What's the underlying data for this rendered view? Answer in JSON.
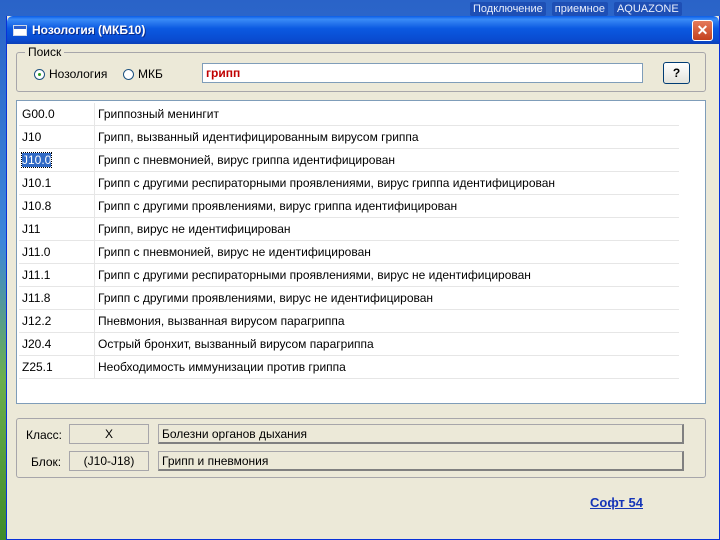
{
  "taskbar": {
    "items": [
      "Подключение",
      "приемное",
      "AQUAZONE"
    ]
  },
  "window": {
    "title": "Нозология (МКБ10)",
    "close_label": "✕"
  },
  "search": {
    "group_label": "Поиск",
    "radio_nosology": "Нозология",
    "radio_mkb": "МКБ",
    "selected": "Нозология",
    "query": "грипп",
    "help_label": "?"
  },
  "results": [
    {
      "code": "G00.0",
      "desc": "Гриппозный менингит"
    },
    {
      "code": "J10",
      "desc": "Грипп, вызванный идентифицированным вирусом гриппа"
    },
    {
      "code": "J10.0",
      "desc": "Грипп с пневмонией, вирус гриппа идентифицирован"
    },
    {
      "code": "J10.1",
      "desc": "Грипп с другими респираторными проявлениями, вирус гриппа идентифицирован"
    },
    {
      "code": "J10.8",
      "desc": "Грипп с другими проявлениями, вирус гриппа идентифицирован"
    },
    {
      "code": "J11",
      "desc": "Грипп, вирус не идентифицирован"
    },
    {
      "code": "J11.0",
      "desc": "Грипп с пневмонией, вирус не идентифицирован"
    },
    {
      "code": "J11.1",
      "desc": "Грипп с другими респираторными проявлениями, вирус не идентифицирован"
    },
    {
      "code": "J11.8",
      "desc": "Грипп с другими проявлениями, вирус не идентифицирован"
    },
    {
      "code": "J12.2",
      "desc": "Пневмония, вызванная вирусом парагриппа"
    },
    {
      "code": "J20.4",
      "desc": "Острый бронхит, вызванный вирусом парагриппа"
    },
    {
      "code": "Z25.1",
      "desc": "Необходимость иммунизации против гриппа"
    }
  ],
  "selected_code": "J10.0",
  "info": {
    "class_label": "Класс:",
    "class_code": "X",
    "class_desc": "Болезни органов дыхания",
    "block_label": "Блок:",
    "block_code": "(J10-J18)",
    "block_desc": "Грипп и пневмония"
  },
  "footer": {
    "link": "Софт 54"
  },
  "colors": {
    "selection": "#316ac5",
    "query_text": "#c00000",
    "link": "#1535b8"
  }
}
